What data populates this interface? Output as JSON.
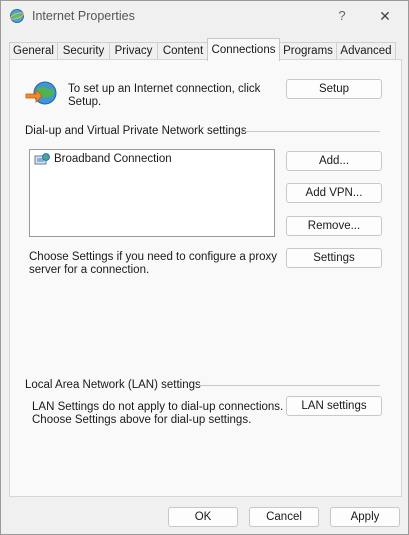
{
  "window": {
    "title": "Internet Properties",
    "help_glyph": "?",
    "close_glyph": "✕"
  },
  "tabs": [
    {
      "label": "General"
    },
    {
      "label": "Security"
    },
    {
      "label": "Privacy"
    },
    {
      "label": "Content"
    },
    {
      "label": "Connections",
      "active": true
    },
    {
      "label": "Programs"
    },
    {
      "label": "Advanced"
    }
  ],
  "setup": {
    "text_line1": "To set up an Internet connection, click",
    "text_line2": "Setup.",
    "button": "Setup"
  },
  "dialup": {
    "group_label": "Dial-up and Virtual Private Network settings",
    "connections": [
      {
        "name": "Broadband Connection"
      }
    ],
    "add_button": "Add...",
    "add_vpn_button": "Add VPN...",
    "remove_button": "Remove...",
    "settings_text_line1": "Choose Settings if you need to configure a proxy",
    "settings_text_line2": "server for a connection.",
    "settings_button": "Settings"
  },
  "lan": {
    "group_label": "Local Area Network (LAN) settings",
    "text_line1": "LAN Settings do not apply to dial-up connections.",
    "text_line2": "Choose Settings above for dial-up settings.",
    "button": "LAN settings"
  },
  "footer": {
    "ok": "OK",
    "cancel": "Cancel",
    "apply": "Apply"
  }
}
